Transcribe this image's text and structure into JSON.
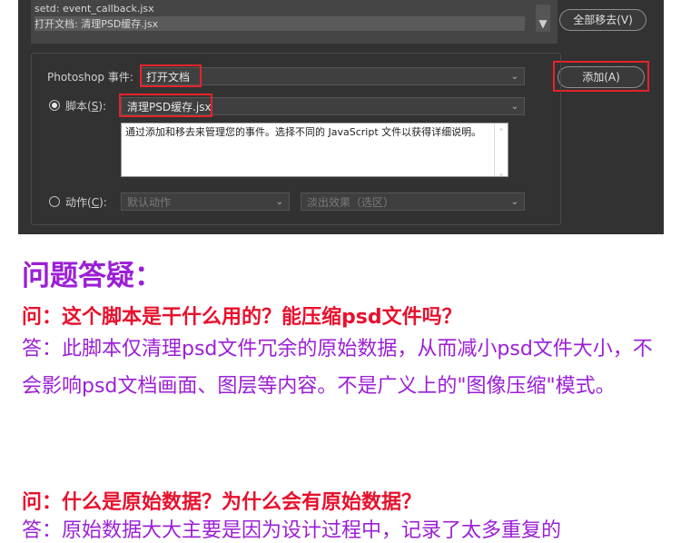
{
  "dialog": {
    "log_lines": [
      "setd: event_callback.jsx",
      "打开文档: 清理PSD缓存.jsx"
    ],
    "remove_all_button": "全部移去(V)",
    "add_button": "添加(A)",
    "event_label": "Photoshop 事件:",
    "event_value": "打开文档",
    "script_label_prefix": "脚本(",
    "script_label_key": "S",
    "script_label_suffix": "):",
    "script_value": "清理PSD缓存.jsx",
    "description": "通过添加和移去来管理您的事件。选择不同的 JavaScript 文件以获得详细说明。",
    "action_label_prefix": "动作(",
    "action_label_key": "C",
    "action_label_suffix": "):",
    "action_set_value": "默认动作",
    "action_value": "淡出效果（选区）",
    "script_selected": true
  },
  "faq": {
    "title": "问题答疑：",
    "q1": "问：这个脚本是干什么用的？能压缩psd文件吗？",
    "a1": "答：此脚本仅清理psd文件冗余的原始数据，从而减小psd文件大小，不会影响psd文档画面、图层等内容。不是广义上的\"图像压缩\"模式。",
    "q2": "问：什么是原始数据？为什么会有原始数据？",
    "a2": "答：原始数据大大主要是因为设计过程中，记录了太多重复的"
  },
  "colors": {
    "highlight_red": "#e4232b",
    "faq_purple": "#9b1fd6",
    "question_red": "#e8112d"
  }
}
